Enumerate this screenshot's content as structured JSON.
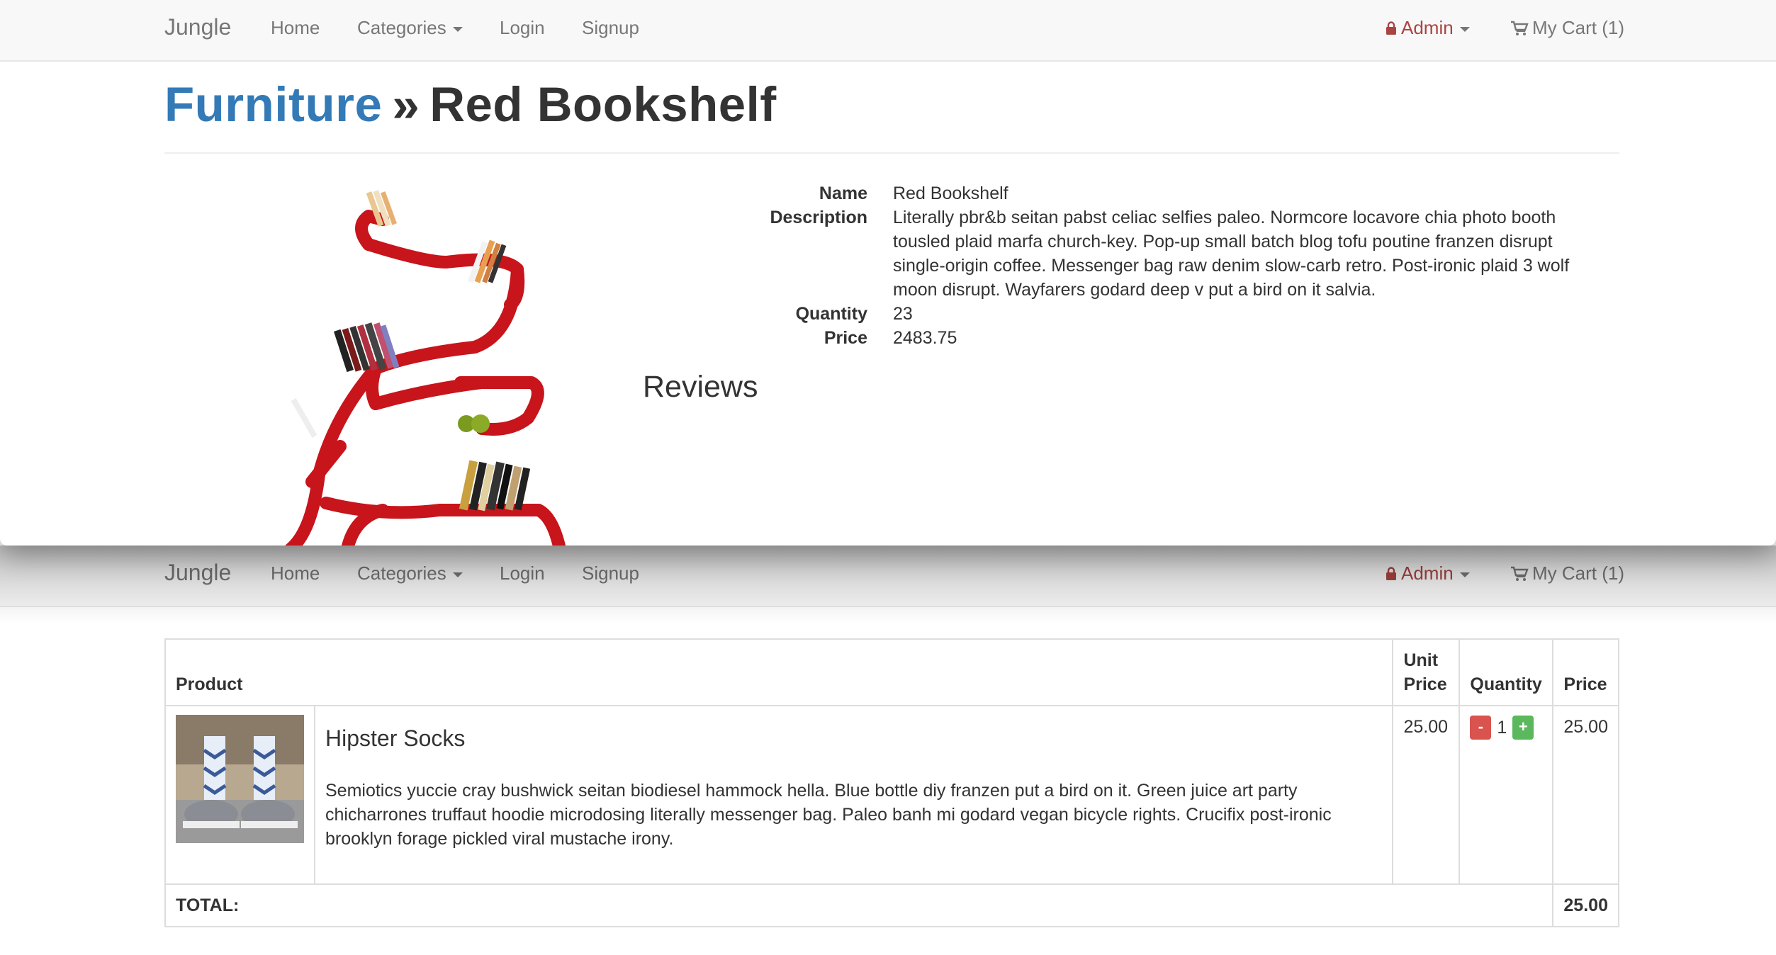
{
  "nav": {
    "brand": "Jungle",
    "home": "Home",
    "categories": "Categories",
    "login": "Login",
    "signup": "Signup",
    "admin": "Admin",
    "cart": "My Cart (1)",
    "admin_color": "#a94442"
  },
  "product_page": {
    "category": "Furniture",
    "separator": "»",
    "product_title": "Red Bookshelf",
    "fields": {
      "name_label": "Name",
      "name_value": "Red Bookshelf",
      "description_label": "Description",
      "description_value": "Literally pbr&b seitan pabst celiac selfies paleo. Normcore locavore chia photo booth tousled plaid marfa church-key. Pop-up small batch blog tofu poutine franzen disrupt single-origin coffee. Messenger bag raw denim slow-carb retro. Post-ironic plaid 3 wolf moon disrupt. Wayfarers godard deep v put a bird on it salvia.",
      "quantity_label": "Quantity",
      "quantity_value": "23",
      "price_label": "Price",
      "price_value": "2483.75"
    },
    "reviews_heading": "Reviews"
  },
  "cart_page": {
    "headers": {
      "product": "Product",
      "unit_price": "Unit Price",
      "quantity": "Quantity",
      "price": "Price"
    },
    "items": [
      {
        "name": "Hipster Socks",
        "description": "Semiotics yuccie cray bushwick seitan biodiesel hammock hella. Blue bottle diy franzen put a bird on it. Green juice art party chicharrones truffaut hoodie microdosing literally messenger bag. Paleo banh mi godard vegan bicycle rights. Crucifix post-ironic brooklyn forage pickled viral mustache irony.",
        "unit_price": "25.00",
        "quantity": "1",
        "minus": "-",
        "plus": "+",
        "price": "25.00"
      }
    ],
    "total_label": "TOTAL:",
    "total_value": "25.00"
  }
}
